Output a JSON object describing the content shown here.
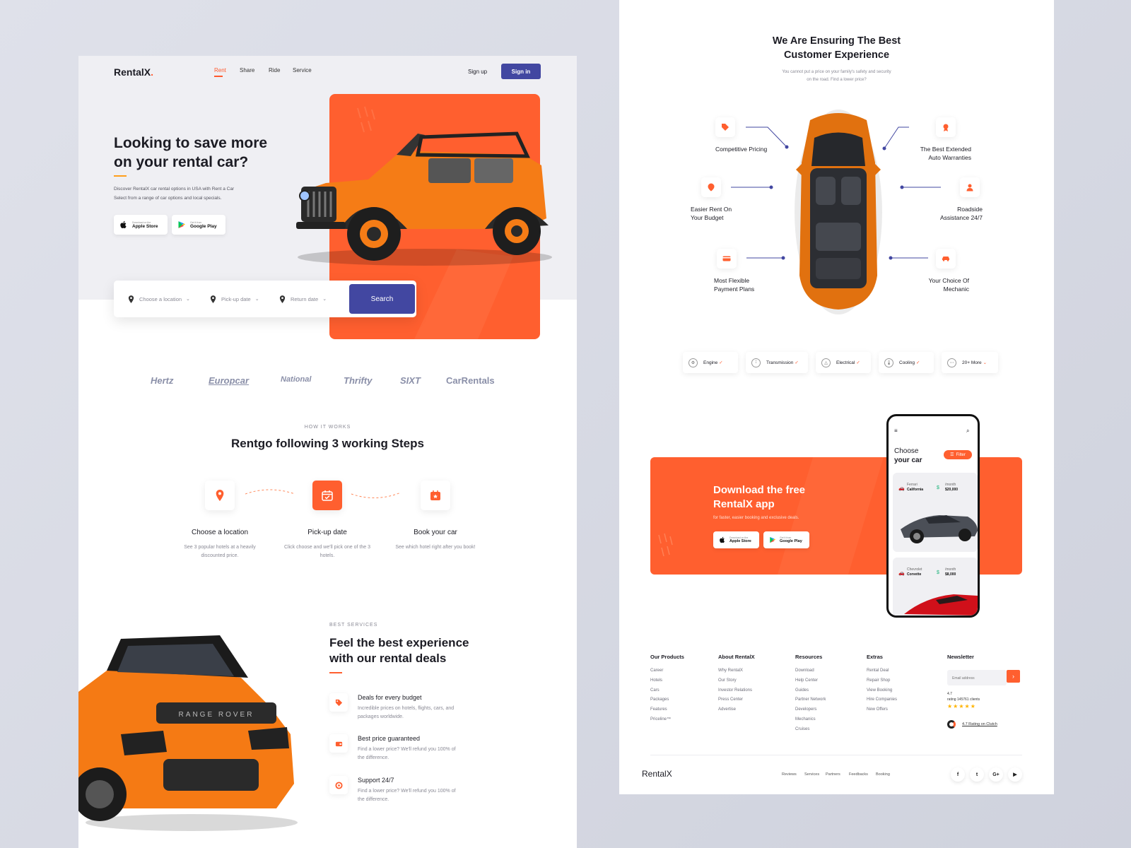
{
  "left": {
    "logo": "RentalX",
    "logo_dot": ".",
    "nav": [
      "Rent",
      "Share",
      "Ride",
      "Service"
    ],
    "signup": "Sign up",
    "signin": "Sign in",
    "hero_title_1": "Looking to save more",
    "hero_title_2": "on your rental car?",
    "hero_desc_1": "Discover RentalX car rental options in USA with  Rent a Car",
    "hero_desc_2": "Select from a range of car options and local specials.",
    "apple_small": "Download on the",
    "apple_big": "Apple Store",
    "google_small": "Get it from",
    "google_big": "Google Play",
    "search": {
      "location": "Choose a location",
      "pickup": "Pick-up date",
      "return": "Return date",
      "button": "Search"
    },
    "brands": [
      "Hertz",
      "Europcar",
      "National",
      "Thrifty",
      "SIXT",
      "CarRentals"
    ],
    "how_kicker": "HOW IT WORKS",
    "how_title": "Rentgo following 3 working Steps",
    "steps": [
      {
        "title": "Choose a location",
        "desc": "See 3 popular hotels at a heavily discounted price."
      },
      {
        "title": "Pick-up date",
        "desc": "Click choose and we'll pick one of the 3 hotels."
      },
      {
        "title": "Book your car",
        "desc": "See which hotel right after you book!"
      }
    ],
    "services_kicker": "BEST SERVICES",
    "services_title_1": "Feel the best experience",
    "services_title_2": "with our rental deals",
    "features": [
      {
        "title": "Deals for every budget",
        "desc": "Incredible prices on hotels, flights, cars, and packages worldwide."
      },
      {
        "title": "Best price guaranteed",
        "desc": "Find a lower price? We'll refund you 100% of the difference."
      },
      {
        "title": "Support 24/7",
        "desc": "Find a lower price? We'll refund you 100% of the difference."
      }
    ]
  },
  "right": {
    "title_1": "We Are Ensuring The Best",
    "title_2": "Customer Experience",
    "sub_1": "You cannot put a price on your family's safety and security",
    "sub_2": "on the road. Find a lower price?",
    "features": [
      {
        "l1": "Competitive Pricing",
        "l2": ""
      },
      {
        "l1": "The Best Extended",
        "l2": "Auto Warranties"
      },
      {
        "l1": "Easier Rent On",
        "l2": "Your Budget"
      },
      {
        "l1": "Roadside",
        "l2": "Assistance 24/7"
      },
      {
        "l1": "Most Flexible",
        "l2": "Payment Plans"
      },
      {
        "l1": "Your Choice Of",
        "l2": "Mechanic"
      }
    ],
    "chips": [
      "Engine",
      "Transmission",
      "Electrical",
      "Cooling",
      "20+ More"
    ],
    "download_title_1": "Download the free",
    "download_title_2": "RentalX app",
    "download_sub": "for faster, easier booking and exclusive deals.",
    "apple_small": "Download on the",
    "apple_big": "Apple Store",
    "google_small": "Get it from",
    "google_big": "Google Play",
    "phone": {
      "title_1": "Choose",
      "title_2": "your car",
      "filter": "Filter",
      "cars": [
        {
          "make": "Ferrari",
          "model": "California",
          "per": "/month",
          "price": "$20,000"
        },
        {
          "make": "Chevrolet",
          "model": "Corvette",
          "per": "/month",
          "price": "$8,000"
        }
      ]
    },
    "footer": {
      "cols": [
        {
          "head": "Our Products",
          "items": [
            "Career",
            "Hotels",
            "Cars",
            "Packages",
            "Features",
            "Priceline™"
          ]
        },
        {
          "head": "About RentalX",
          "items": [
            "Why RentalX",
            "Our Story",
            "Investor Relations",
            "Press Center",
            "Advertise"
          ]
        },
        {
          "head": "Resources",
          "items": [
            "Download",
            "Help Center",
            "Guides",
            "Partner Network",
            "Developers",
            "Mechanics",
            "Cruises"
          ]
        },
        {
          "head": "Extras",
          "items": [
            "Rental Deal",
            "Repair Shop",
            "View Booking",
            "Hire Companies",
            "New Offers"
          ]
        }
      ],
      "newsletter": "Newsletter",
      "email_placeholder": "Email address",
      "rating": "4.7",
      "rating_text": "rating 145761 clients",
      "clutch": "4.7 Rating on Clutch",
      "logo": "RentalX",
      "links": [
        "Reviews",
        "Services",
        "Partners",
        "Feedbacks",
        "Booking"
      ],
      "socials": [
        "f",
        "t",
        "G+",
        "▶"
      ]
    }
  },
  "colors": {
    "accent": "#ff5f2f",
    "primary": "#4247a1",
    "text": "#1c1c24",
    "muted": "#8a8a95"
  }
}
